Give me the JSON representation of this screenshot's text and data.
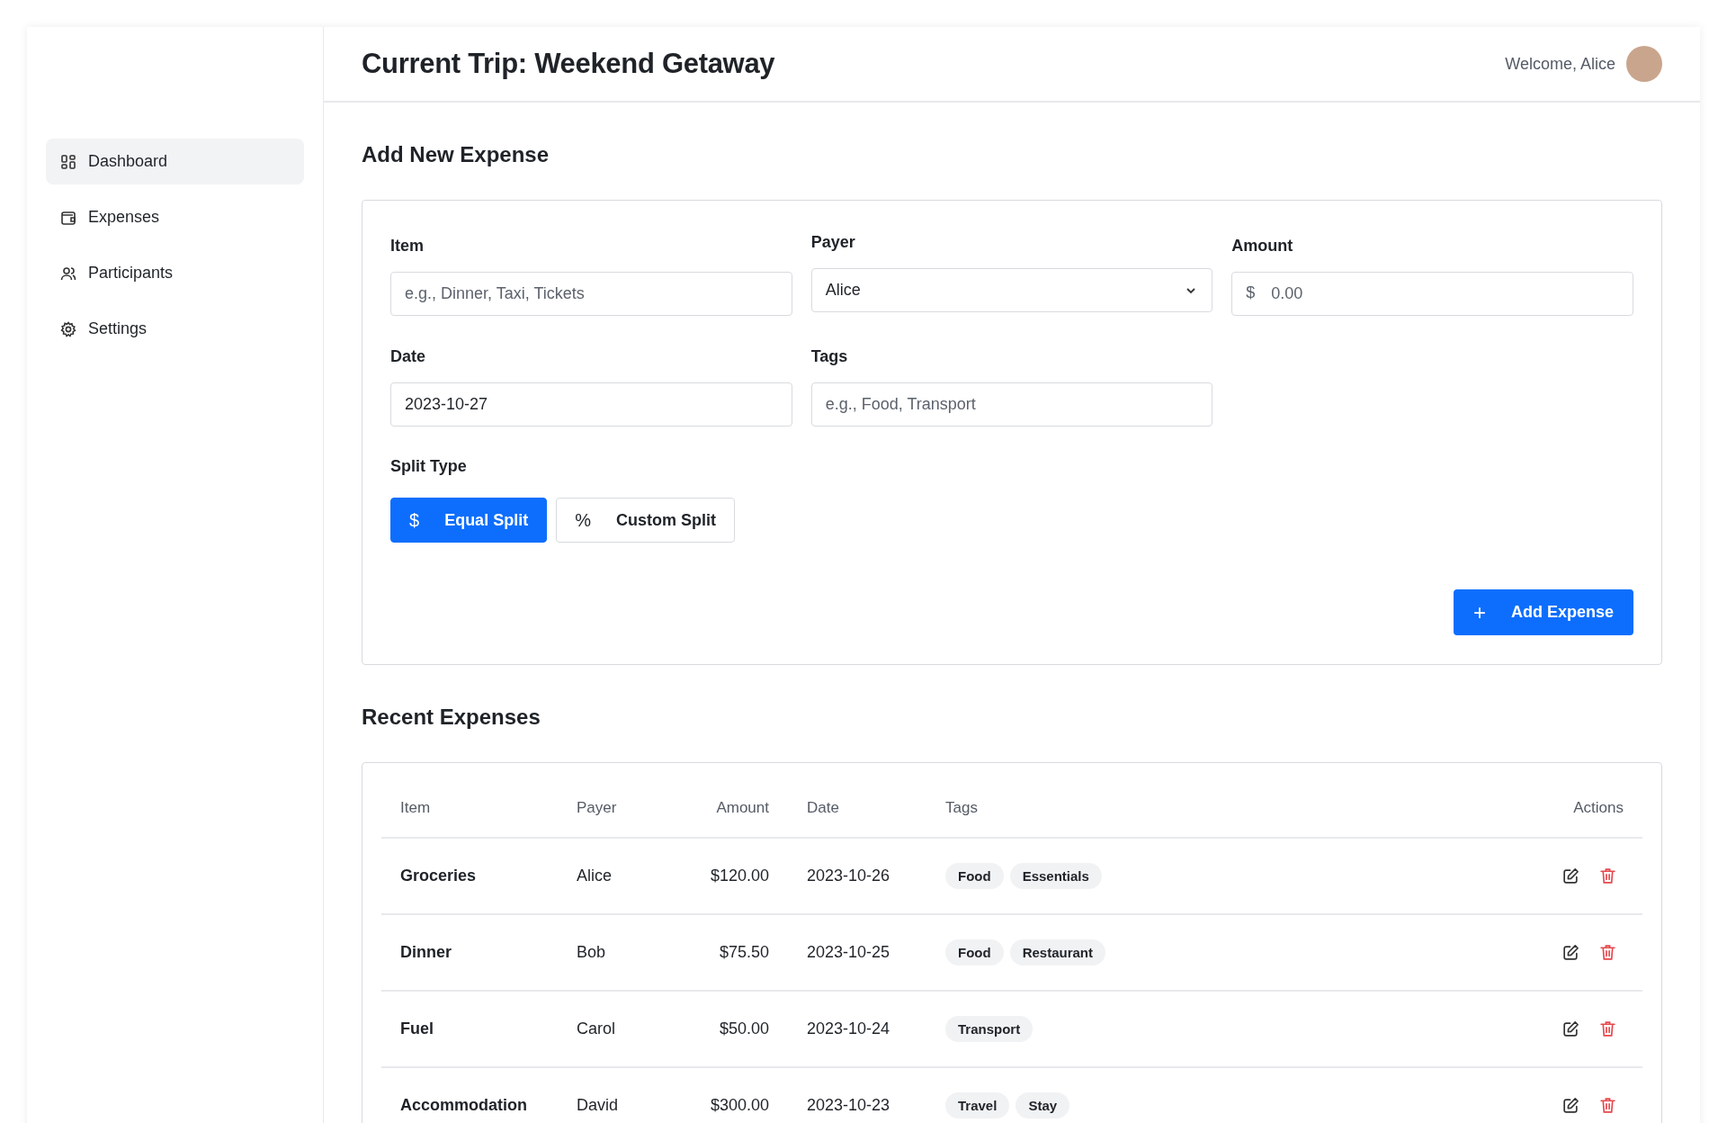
{
  "sidebar": {
    "items": [
      {
        "label": "Dashboard",
        "kind": "grid",
        "selected": true
      },
      {
        "label": "Expenses",
        "kind": "wallet",
        "selected": false
      },
      {
        "label": "Participants",
        "kind": "users",
        "selected": false
      },
      {
        "label": "Settings",
        "kind": "gear",
        "selected": false
      }
    ]
  },
  "header": {
    "title": "Current Trip: Weekend Getaway",
    "welcome": "Welcome, Alice"
  },
  "form": {
    "title": "Add New Expense",
    "item": {
      "label": "Item",
      "placeholder": "e.g., Dinner, Taxi, Tickets"
    },
    "payer": {
      "label": "Payer",
      "value": "Alice"
    },
    "amount": {
      "label": "Amount",
      "prefix": "$",
      "placeholder": "0.00"
    },
    "date": {
      "label": "Date",
      "value": "2023-10-27"
    },
    "tags": {
      "label": "Tags",
      "placeholder": "e.g., Food, Transport"
    },
    "split_type": {
      "label": "Split Type",
      "options": [
        {
          "symbol": "$",
          "label": "Equal Split",
          "selected": true
        },
        {
          "symbol": "%",
          "label": "Custom Split",
          "selected": false
        }
      ]
    },
    "submit": {
      "symbol": "+",
      "label": "Add Expense"
    }
  },
  "recent": {
    "title": "Recent Expenses",
    "columns": [
      "Item",
      "Payer",
      "Amount",
      "Date",
      "Tags",
      "Actions"
    ],
    "rows": [
      {
        "item": "Groceries",
        "payer": "Alice",
        "amount": "$120.00",
        "date": "2023-10-26",
        "tags": [
          "Food",
          "Essentials"
        ]
      },
      {
        "item": "Dinner",
        "payer": "Bob",
        "amount": "$75.50",
        "date": "2023-10-25",
        "tags": [
          "Food",
          "Restaurant"
        ]
      },
      {
        "item": "Fuel",
        "payer": "Carol",
        "amount": "$50.00",
        "date": "2023-10-24",
        "tags": [
          "Transport"
        ]
      },
      {
        "item": "Accommodation",
        "payer": "David",
        "amount": "$300.00",
        "date": "2023-10-23",
        "tags": [
          "Travel",
          "Stay"
        ]
      }
    ]
  }
}
